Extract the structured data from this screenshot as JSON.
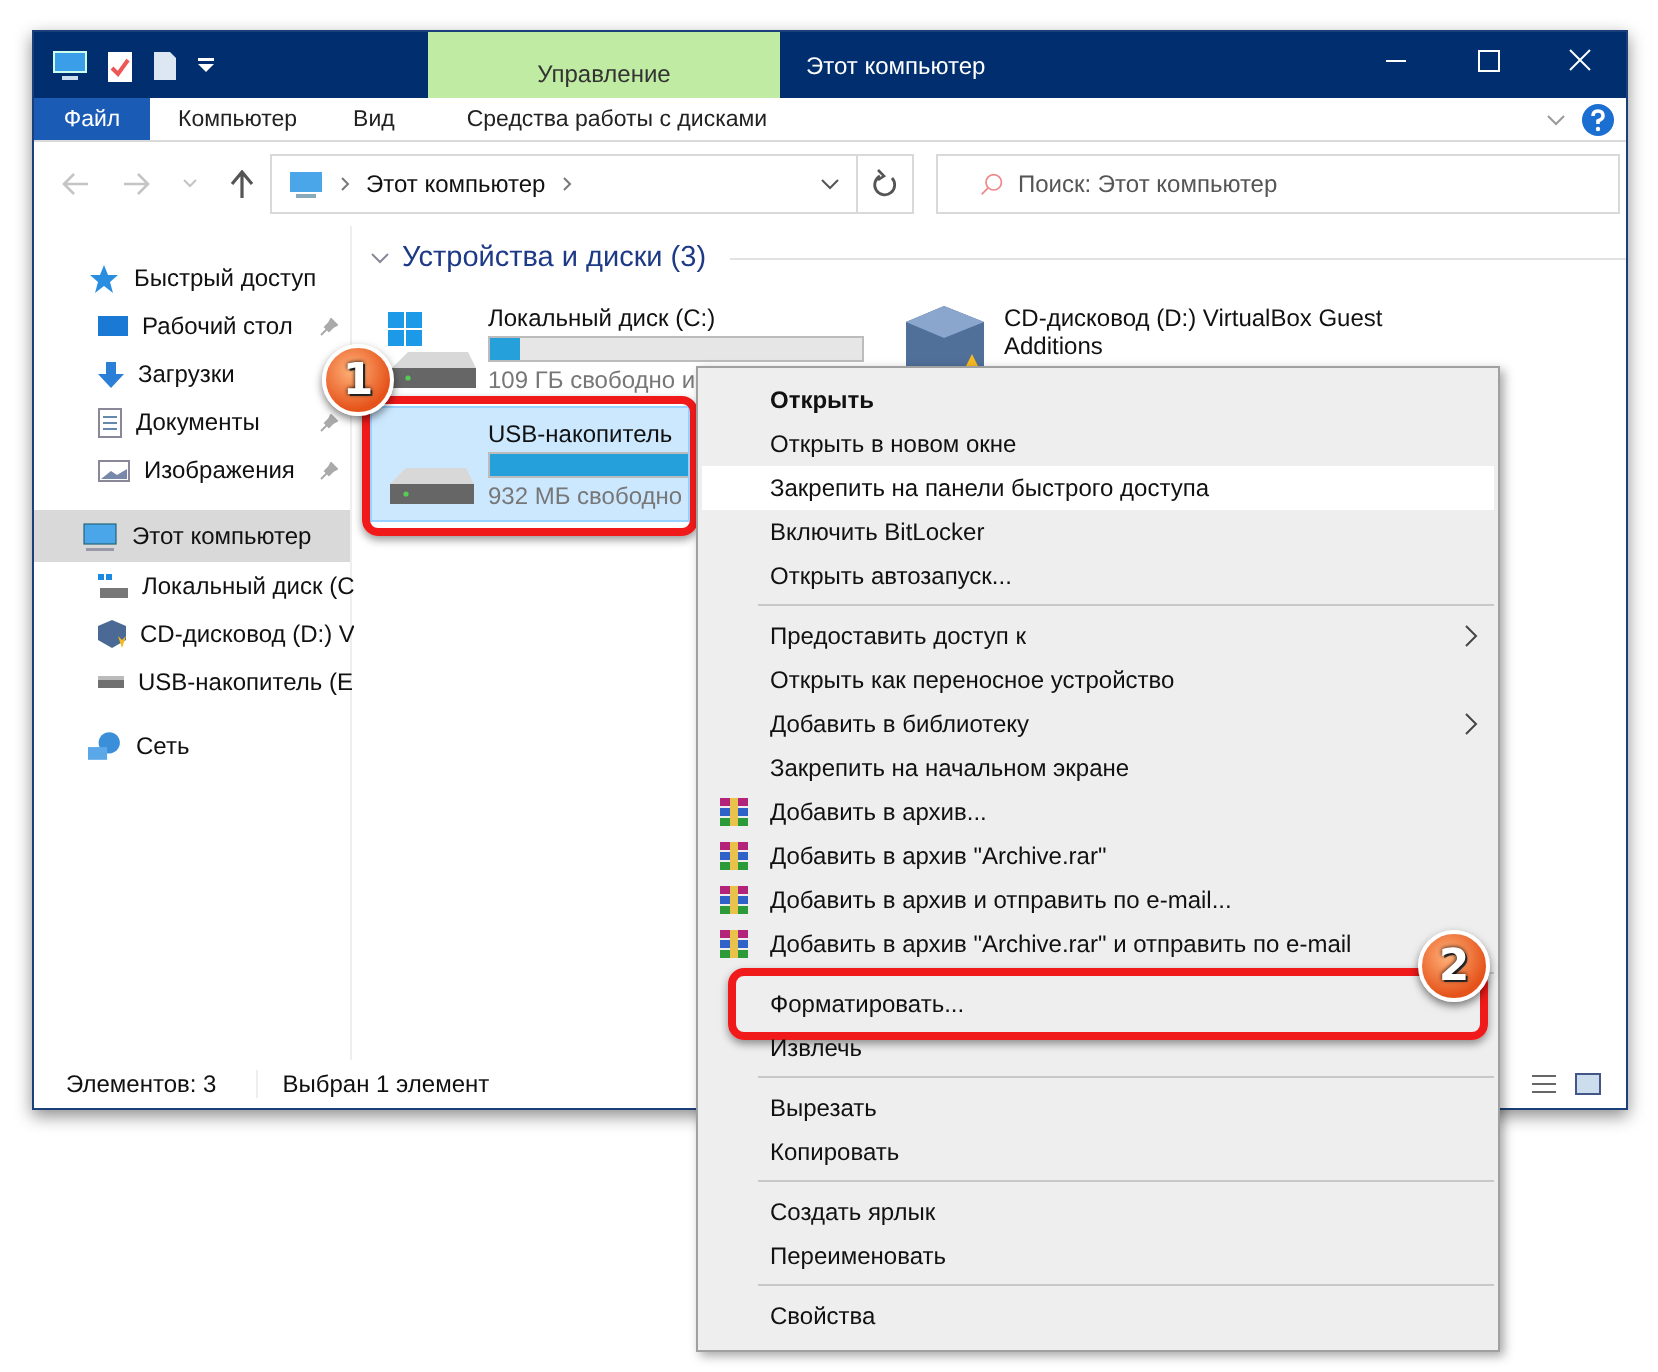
{
  "window": {
    "title": "Этот компьютер",
    "context_tab": "Управление"
  },
  "ribbon_tabs": [
    {
      "label": "Файл",
      "kind": "file"
    },
    {
      "label": "Компьютер",
      "kind": "tab"
    },
    {
      "label": "Вид",
      "kind": "tab"
    },
    {
      "label": "Средства работы с дисками",
      "kind": "tab"
    }
  ],
  "address": {
    "path": "Этот компьютер"
  },
  "search": {
    "placeholder": "Поиск: Этот компьютер"
  },
  "sidebar": {
    "items": [
      {
        "label": "Быстрый доступ",
        "kind": "star",
        "selected": false,
        "children": [
          {
            "label": "Рабочий стол",
            "kind": "desktop",
            "pinned": true,
            "selected": false
          },
          {
            "label": "Загрузки",
            "kind": "download",
            "pinned": false,
            "selected": false
          },
          {
            "label": "Документы",
            "kind": "document",
            "pinned": true,
            "selected": false
          },
          {
            "label": "Изображения",
            "kind": "image",
            "pinned": true,
            "selected": false
          }
        ]
      },
      {
        "label": "Этот компьютер",
        "kind": "pc",
        "selected": true,
        "children": [
          {
            "label": "Локальный диск (C",
            "kind": "system-drive",
            "pinned": false,
            "selected": false
          },
          {
            "label": "CD-дисковод (D:) V",
            "kind": "cube",
            "pinned": false,
            "selected": false
          },
          {
            "label": "USB-накопитель (E",
            "kind": "drive",
            "pinned": false,
            "selected": false
          }
        ]
      },
      {
        "label": "Сеть",
        "kind": "network",
        "selected": false
      }
    ]
  },
  "section": {
    "title": "Устройства и диски (3)",
    "expanded": true
  },
  "drives": [
    {
      "name": "Локальный диск (C:)",
      "free": "109 ГБ свободно и",
      "level": 0.08,
      "kind": "system-drive",
      "selected": false
    },
    {
      "name": "CD-дисковод (D:) VirtualBox Guest Additions",
      "kind": "cube",
      "selected": false
    },
    {
      "name": "USB-накопитель",
      "free": "932 МБ свободно",
      "level": 0.97,
      "kind": "drive",
      "selected": true,
      "callout": "1"
    }
  ],
  "status_bar": {
    "count": "Элементов: 3",
    "selection": "Выбран 1 элемент"
  },
  "context_menu": {
    "groups": [
      [
        {
          "label": "Открыть",
          "kind": "plain",
          "default": true,
          "submenu": false,
          "selected": false
        },
        {
          "label": "Открыть в новом окне",
          "kind": "plain",
          "default": false,
          "submenu": false,
          "selected": false
        },
        {
          "label": "Закрепить на панели быстрого доступа",
          "kind": "plain",
          "default": false,
          "submenu": false,
          "selected": true
        },
        {
          "label": "Включить BitLocker",
          "kind": "plain",
          "default": false,
          "submenu": false,
          "selected": false
        },
        {
          "label": "Открыть автозапуск...",
          "kind": "plain",
          "default": false,
          "submenu": false,
          "selected": false
        }
      ],
      [
        {
          "label": "Предоставить доступ к",
          "kind": "plain",
          "default": false,
          "submenu": true,
          "selected": false
        },
        {
          "label": "Открыть как переносное устройство",
          "kind": "plain",
          "default": false,
          "submenu": false,
          "selected": false
        },
        {
          "label": "Добавить в библиотеку",
          "kind": "plain",
          "default": false,
          "submenu": true,
          "selected": false
        },
        {
          "label": "Закрепить на начальном экране",
          "kind": "plain",
          "default": false,
          "submenu": false,
          "selected": false
        },
        {
          "label": "Добавить в архив...",
          "kind": "archive",
          "default": false,
          "submenu": false,
          "selected": false
        },
        {
          "label": "Добавить в архив \"Archive.rar\"",
          "kind": "archive",
          "default": false,
          "submenu": false,
          "selected": false
        },
        {
          "label": "Добавить в архив и отправить по e-mail...",
          "kind": "archive",
          "default": false,
          "submenu": false,
          "selected": false
        },
        {
          "label": "Добавить в архив \"Archive.rar\" и отправить по e-mail",
          "kind": "archive",
          "default": false,
          "submenu": false,
          "selected": false
        }
      ],
      [
        {
          "label": "Форматировать...",
          "kind": "plain",
          "default": false,
          "submenu": false,
          "selected": false,
          "callout": "2"
        },
        {
          "label": "Извлечь",
          "kind": "plain",
          "default": false,
          "submenu": false,
          "selected": false
        }
      ],
      [
        {
          "label": "Вырезать",
          "kind": "plain",
          "default": false,
          "submenu": false,
          "selected": false
        },
        {
          "label": "Копировать",
          "kind": "plain",
          "default": false,
          "submenu": false,
          "selected": false
        }
      ],
      [
        {
          "label": "Создать ярлык",
          "kind": "plain",
          "default": false,
          "submenu": false,
          "selected": false
        },
        {
          "label": "Переименовать",
          "kind": "plain",
          "default": false,
          "submenu": false,
          "selected": false
        }
      ],
      [
        {
          "label": "Свойства",
          "kind": "plain",
          "default": false,
          "submenu": false,
          "selected": false
        }
      ]
    ]
  }
}
